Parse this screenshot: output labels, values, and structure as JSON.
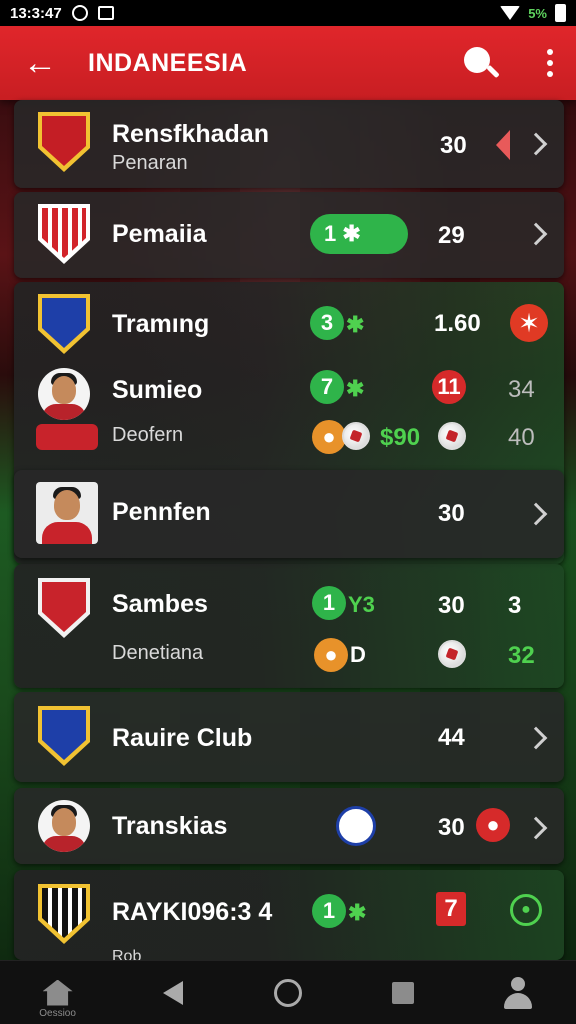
{
  "status_bar": {
    "time": "13:3:47",
    "right_text": "5%"
  },
  "app_bar": {
    "title": "INDANEESIA",
    "back_icon": "arrow-left-icon",
    "search_icon": "search-icon",
    "more_icon": "more-vertical-icon"
  },
  "colors": {
    "accent": "#d8242a",
    "green": "#2fb44a",
    "card": "#282828"
  },
  "rows": [
    {
      "name": "Rensfkhadan",
      "sub": "Penaran",
      "value": "30"
    },
    {
      "name": "Pemaiia",
      "pill": "1 ✱",
      "value": "29"
    },
    {
      "name": "Tramıng",
      "badge": "3",
      "badge_suffix": "✱",
      "value": "1.60"
    },
    {
      "name": "Sumieo",
      "badge": "7",
      "badge_suffix": "✱",
      "value": "11",
      "value2": "34"
    },
    {
      "sub": "Deofern",
      "suffix": "$90",
      "value2": "40"
    },
    {
      "name": "Pennfen",
      "value": "30"
    },
    {
      "name": "Sambes",
      "badge": "1",
      "badge_suffix": "Y3",
      "value": "30",
      "value2": "3"
    },
    {
      "sub": "Denetiana",
      "suffix": "D",
      "value2": "32"
    },
    {
      "name": "Rauire Club",
      "value": "44"
    },
    {
      "name": "Transkias",
      "value": "30"
    },
    {
      "name": "RAYKI096:3 4",
      "badge": "1",
      "badge_suffix": "✱",
      "tag": "7"
    },
    {
      "sub": "Rob"
    }
  ],
  "nav": {
    "home_label": "Oessioo"
  }
}
